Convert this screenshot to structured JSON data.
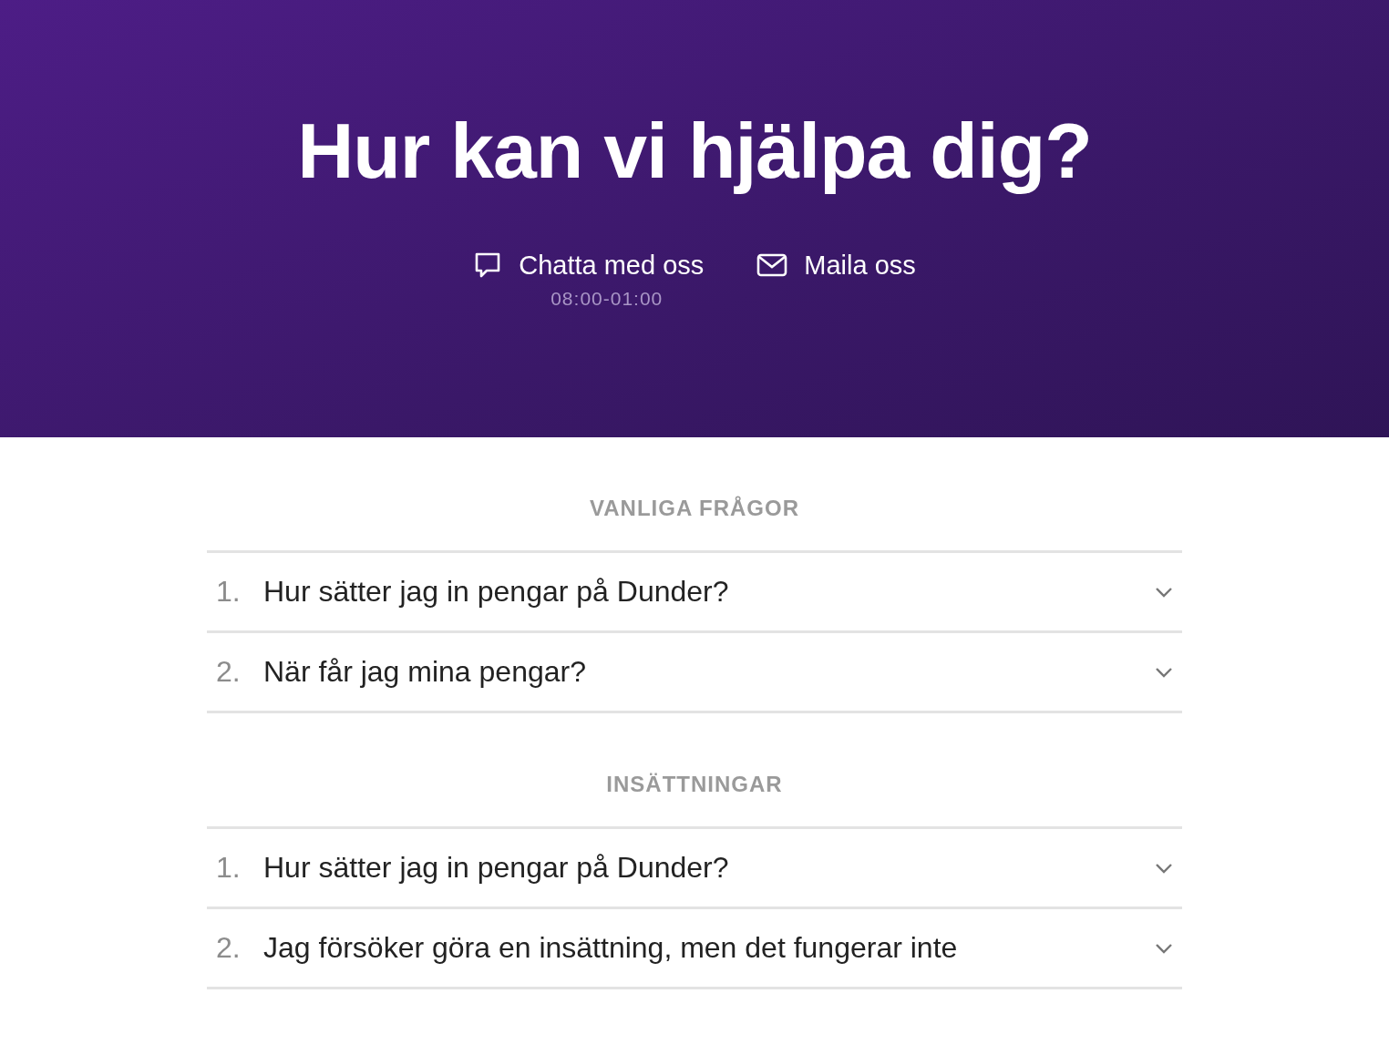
{
  "header": {
    "title": "Hur kan vi hjälpa dig?",
    "contacts": [
      {
        "kind": "chat",
        "label": "Chatta med oss",
        "hours": "08:00-01:00"
      },
      {
        "kind": "mail",
        "label": "Maila oss"
      }
    ]
  },
  "sections": [
    {
      "heading": "VANLIGA FRÅGOR",
      "questions": [
        {
          "number": "1.",
          "text": "Hur sätter jag in pengar på Dunder?"
        },
        {
          "number": "2.",
          "text": "När får jag mina pengar?"
        }
      ]
    },
    {
      "heading": "INSÄTTNINGAR",
      "questions": [
        {
          "number": "1.",
          "text": "Hur sätter jag in pengar på Dunder?"
        },
        {
          "number": "2.",
          "text": "Jag försöker göra en insättning, men det fungerar inte"
        }
      ]
    }
  ]
}
